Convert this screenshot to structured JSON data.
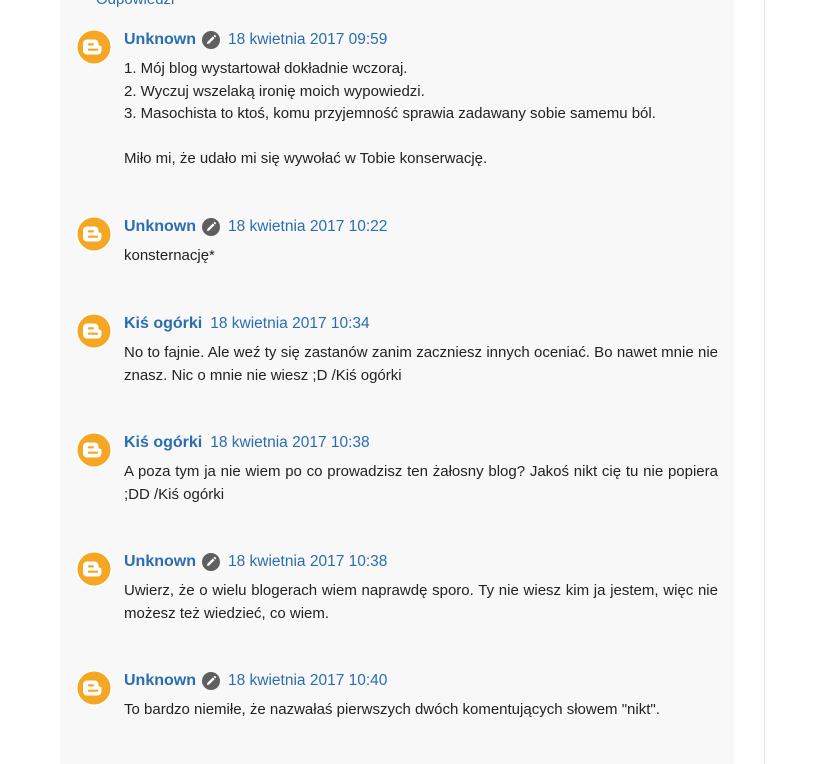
{
  "replies_link": "Odpowiedzi",
  "comments": [
    {
      "author": "Unknown",
      "has_edit_icon": true,
      "date": "18 kwietnia 2017 09:59",
      "lines": [
        "1. Mój blog wystartował dokładnie wczoraj.",
        "2. Wyczuj wszelaką ironię moich wypowiedzi.",
        "3. Masochista to ktoś, komu przyjemność sprawia zadawany sobie samemu ból.",
        "",
        "Miło mi, że udało mi się wywołać w Tobie konserwację."
      ]
    },
    {
      "author": "Unknown",
      "has_edit_icon": true,
      "date": "18 kwietnia 2017 10:22",
      "lines": [
        "konsternację*"
      ]
    },
    {
      "author": "Kiś ogórki",
      "has_edit_icon": false,
      "date": "18 kwietnia 2017 10:34",
      "lines": [
        "No to fajnie. Ale weź ty się zastanów zanim zaczniesz innych oceniać. Bo nawet mnie nie znasz. Nic o mnie nie wiesz ;D /Kiś ogórki"
      ]
    },
    {
      "author": "Kiś ogórki",
      "has_edit_icon": false,
      "date": "18 kwietnia 2017 10:38",
      "lines": [
        "A poza tym ja nie wiem po co prowadzisz ten żałosny blog? Jakoś nikt cię tu nie popiera ;DD /Kiś ogórki"
      ]
    },
    {
      "author": "Unknown",
      "has_edit_icon": true,
      "date": "18 kwietnia 2017 10:38",
      "lines": [
        "Uwierz, że o wielu blogerach wiem naprawdę sporo. Ty nie wiesz kim ja jestem, więc nie możesz też wiedzieć, co wiem."
      ]
    },
    {
      "author": "Unknown",
      "has_edit_icon": true,
      "date": "18 kwietnia 2017 10:40",
      "lines": [
        "To bardzo niemiłe, że nazwałaś pierwszych dwóch komentujących słowem \"nikt\"."
      ]
    }
  ],
  "colors": {
    "link": "#2a6db0",
    "avatar": "#f5a623",
    "panel": "#f8f8f8"
  },
  "icons": {
    "avatar": "blogger-icon",
    "edit": "pencil-icon"
  }
}
